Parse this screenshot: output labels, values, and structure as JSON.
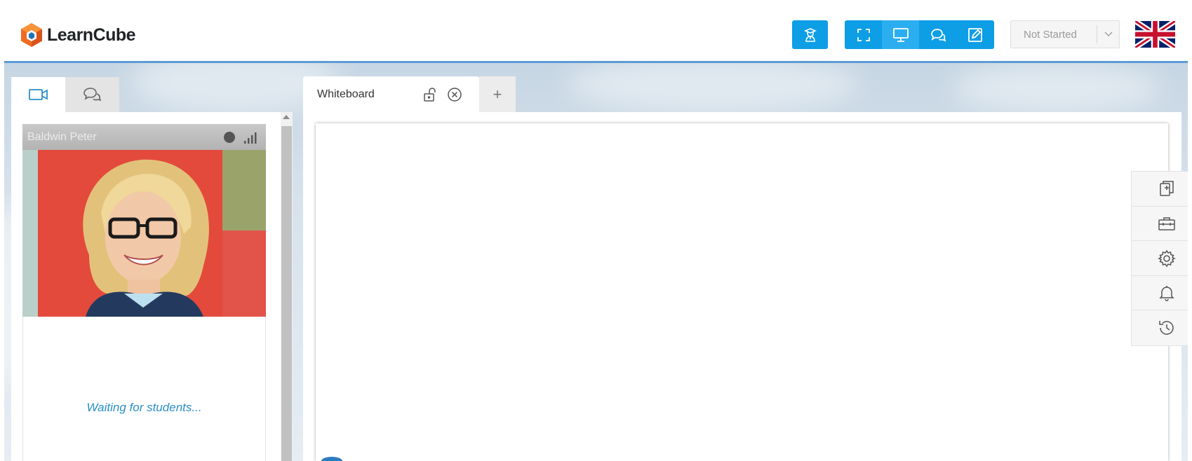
{
  "header": {
    "brand": "LearnCube",
    "status_select": {
      "value": "Not Started"
    },
    "language_flag": "uk-flag",
    "colors": {
      "accent": "#0e9ee6",
      "accent_active": "#2aaef0",
      "rule": "#5b9bd5"
    }
  },
  "toolbar": {
    "teacher_icon": "teacher-icon",
    "group_icons": [
      "fullscreen-icon",
      "screen-share-icon",
      "chat-icon",
      "edit-icon"
    ],
    "active_index": 1
  },
  "left_panel": {
    "tabs": [
      "video-camera-icon",
      "chat-bubbles-icon"
    ],
    "video": {
      "participant_name": "Baldwin Peter",
      "waiting_text": "Waiting for students..."
    }
  },
  "whiteboard": {
    "tabs": [
      {
        "label": "Whiteboard"
      }
    ],
    "add_tab_label": "+",
    "side_tools": [
      "add-page-icon",
      "toolbox-icon",
      "settings-icon",
      "notifications-icon",
      "history-icon"
    ]
  }
}
